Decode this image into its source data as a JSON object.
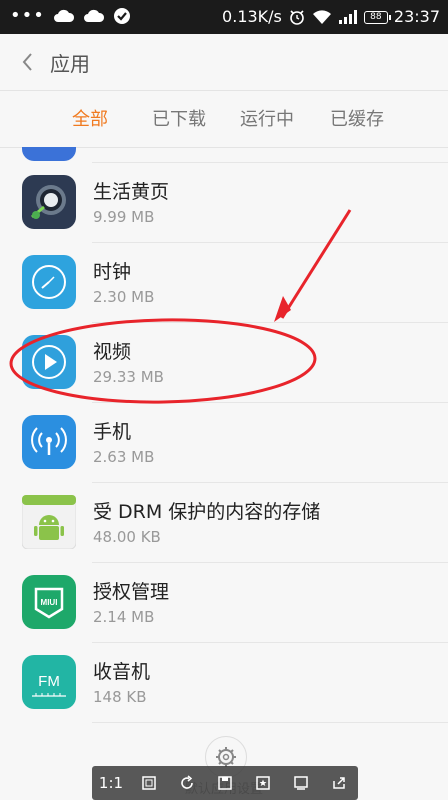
{
  "status_bar": {
    "dots": "•••",
    "speed": "0.13K/s",
    "battery": "88",
    "time": "23:37"
  },
  "header": {
    "title": "应用",
    "back_icon": "chevron-left-icon"
  },
  "tabs": [
    {
      "label": "全部",
      "active": true
    },
    {
      "label": "已下载",
      "active": false
    },
    {
      "label": "运行中",
      "active": false
    },
    {
      "label": "已缓存",
      "active": false
    }
  ],
  "apps": [
    {
      "name": "生活黄页",
      "size": "9.99 MB",
      "icon": "yellow-pages-icon"
    },
    {
      "name": "时钟",
      "size": "2.30 MB",
      "icon": "clock-icon"
    },
    {
      "name": "视频",
      "size": "29.33 MB",
      "icon": "video-play-icon"
    },
    {
      "name": "手机",
      "size": "2.63 MB",
      "icon": "phone-signal-icon"
    },
    {
      "name": "受 DRM 保护的内容的存储",
      "size": "48.00 KB",
      "icon": "android-icon"
    },
    {
      "name": "授权管理",
      "size": "2.14 MB",
      "icon": "miui-badge-icon"
    },
    {
      "name": "收音机",
      "size": "148 KB",
      "icon": "fm-radio-icon"
    }
  ],
  "icon_texts": {
    "miui": "MIUI",
    "fm": "FM"
  },
  "footer": {
    "label": "默认应用设置"
  },
  "viewer_toolbar": {
    "ratio_label": "1:1"
  },
  "colors": {
    "accent": "#f07a20",
    "annotation": "#e8242b"
  }
}
